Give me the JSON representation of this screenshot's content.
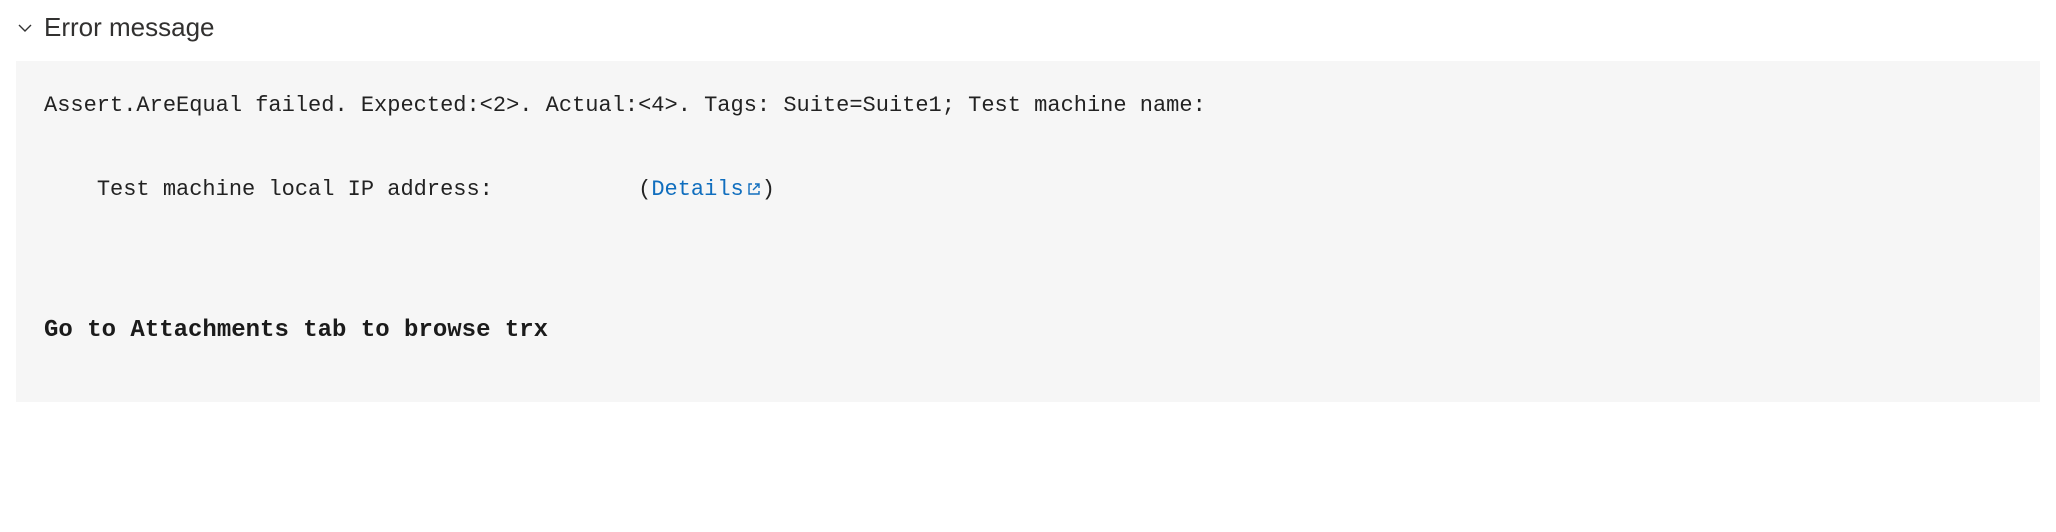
{
  "section": {
    "title": "Error message"
  },
  "error": {
    "line1": "Assert.AreEqual failed. Expected:<2>. Actual:<4>. Tags: Suite=Suite1; Test machine name:",
    "line2_prefix": "Test machine local IP address:           ",
    "details_link_prefix": "(",
    "details_link_label": "Details",
    "details_link_suffix": ")"
  },
  "note": {
    "text": "Go to Attachments tab to browse trx"
  }
}
